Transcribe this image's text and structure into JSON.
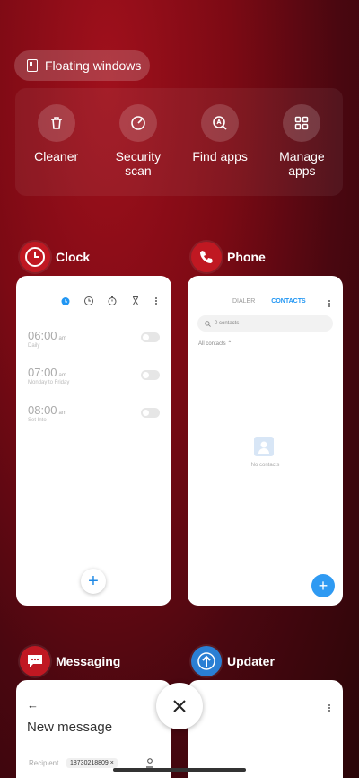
{
  "floating_windows": {
    "label": "Floating windows"
  },
  "tools": [
    {
      "label": "Cleaner",
      "icon": "trash-icon"
    },
    {
      "label": "Security\nscan",
      "icon": "gauge-icon"
    },
    {
      "label": "Find apps",
      "icon": "search-a-icon"
    },
    {
      "label": "Manage\napps",
      "icon": "grid-icon"
    }
  ],
  "apps": {
    "clock": {
      "title": "Clock",
      "alarms": [
        {
          "time": "06:00",
          "ampm": "am",
          "sub": "Daily"
        },
        {
          "time": "07:00",
          "ampm": "am",
          "sub": "Monday to Friday"
        },
        {
          "time": "08:00",
          "ampm": "am",
          "sub": "Set Into"
        }
      ],
      "fab": "+"
    },
    "phone": {
      "title": "Phone",
      "tab_dialer": "DIALER",
      "tab_contacts": "CONTACTS",
      "search_placeholder": "0 contacts",
      "all_contacts": "All contacts",
      "empty": "No contacts",
      "fab": "+"
    },
    "messaging": {
      "title": "Messaging",
      "heading": "New message",
      "recipient_label": "Recipient",
      "recipient_value": "18730218809"
    },
    "updater": {
      "title": "Updater"
    }
  },
  "colors": {
    "accent": "#2196f3",
    "bg": "#7c0a14"
  }
}
